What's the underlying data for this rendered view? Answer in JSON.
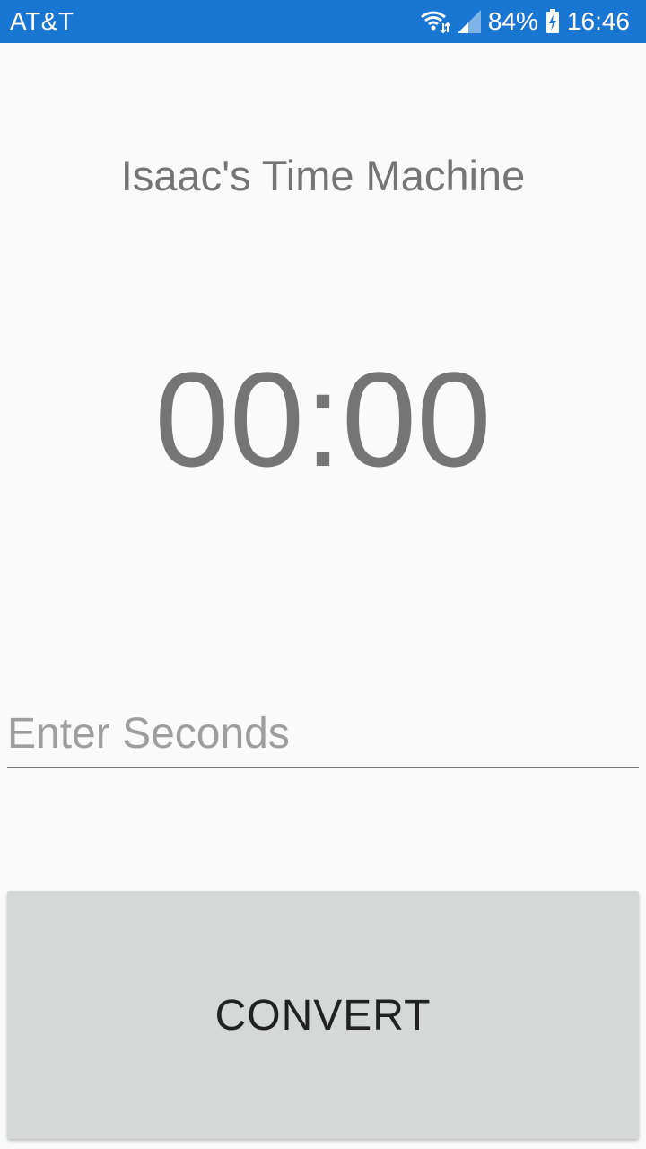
{
  "status_bar": {
    "carrier": "AT&T",
    "battery_percent": "84%",
    "time": "16:46",
    "icons": [
      "wifi-icon",
      "signal-icon",
      "battery-charging-icon"
    ],
    "color": "#1976d2"
  },
  "app": {
    "title": "Isaac's Time Machine",
    "timer_value": "00:00",
    "input_placeholder": "Enter Seconds",
    "input_value": "",
    "convert_label": "CONVERT"
  }
}
